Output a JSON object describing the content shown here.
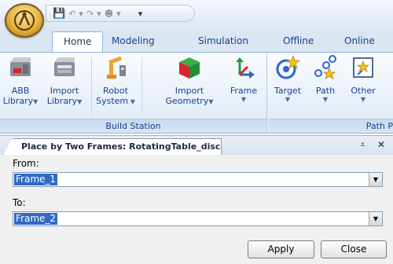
{
  "quick_access": {
    "save_icon": "save-icon",
    "undo_icon": "undo-icon",
    "redo_icon": "redo-icon",
    "user_icon": "user-icon",
    "customize_icon": "customize-icon"
  },
  "tabs": [
    {
      "label": "Home",
      "active": true
    },
    {
      "label": "Modeling"
    },
    {
      "label": "Simulation"
    },
    {
      "label": "Offline"
    },
    {
      "label": "Online"
    }
  ],
  "ribbon": {
    "build_station": {
      "label": "Build Station",
      "buttons": [
        {
          "line1": "ABB",
          "line2": "Library",
          "dropdown": true,
          "icon": "abb-library-icon"
        },
        {
          "line1": "Import",
          "line2": "Library",
          "dropdown": true,
          "icon": "import-library-icon"
        },
        {
          "line1": "Robot",
          "line2": "System",
          "dropdown": true,
          "icon": "robot-icon"
        },
        {
          "line1": "Import",
          "line2": "Geometry",
          "dropdown": true,
          "icon": "geometry-cube-icon"
        },
        {
          "line1": "Frame",
          "line2": "",
          "dropdown": true,
          "icon": "frame-axes-icon"
        }
      ]
    },
    "path_programming": {
      "label": "Path P",
      "buttons": [
        {
          "line1": "Target",
          "dropdown": true,
          "icon": "target-icon"
        },
        {
          "line1": "Path",
          "dropdown": true,
          "icon": "path-icon"
        },
        {
          "line1": "Other",
          "dropdown": true,
          "icon": "other-icon"
        }
      ]
    }
  },
  "panel": {
    "title": "Place by Two Frames: RotatingTable_disc",
    "from_label": "From:",
    "from_value": "Frame_1",
    "to_label": "To:",
    "to_value": "Frame_2",
    "apply_label": "Apply",
    "close_label": "Close",
    "pin_glyph": "⩡",
    "close_glyph": "✕"
  },
  "colors": {
    "ribbon_text": "#15428b",
    "selection": "#316ac5",
    "ribbon_border": "#8db2e3"
  }
}
